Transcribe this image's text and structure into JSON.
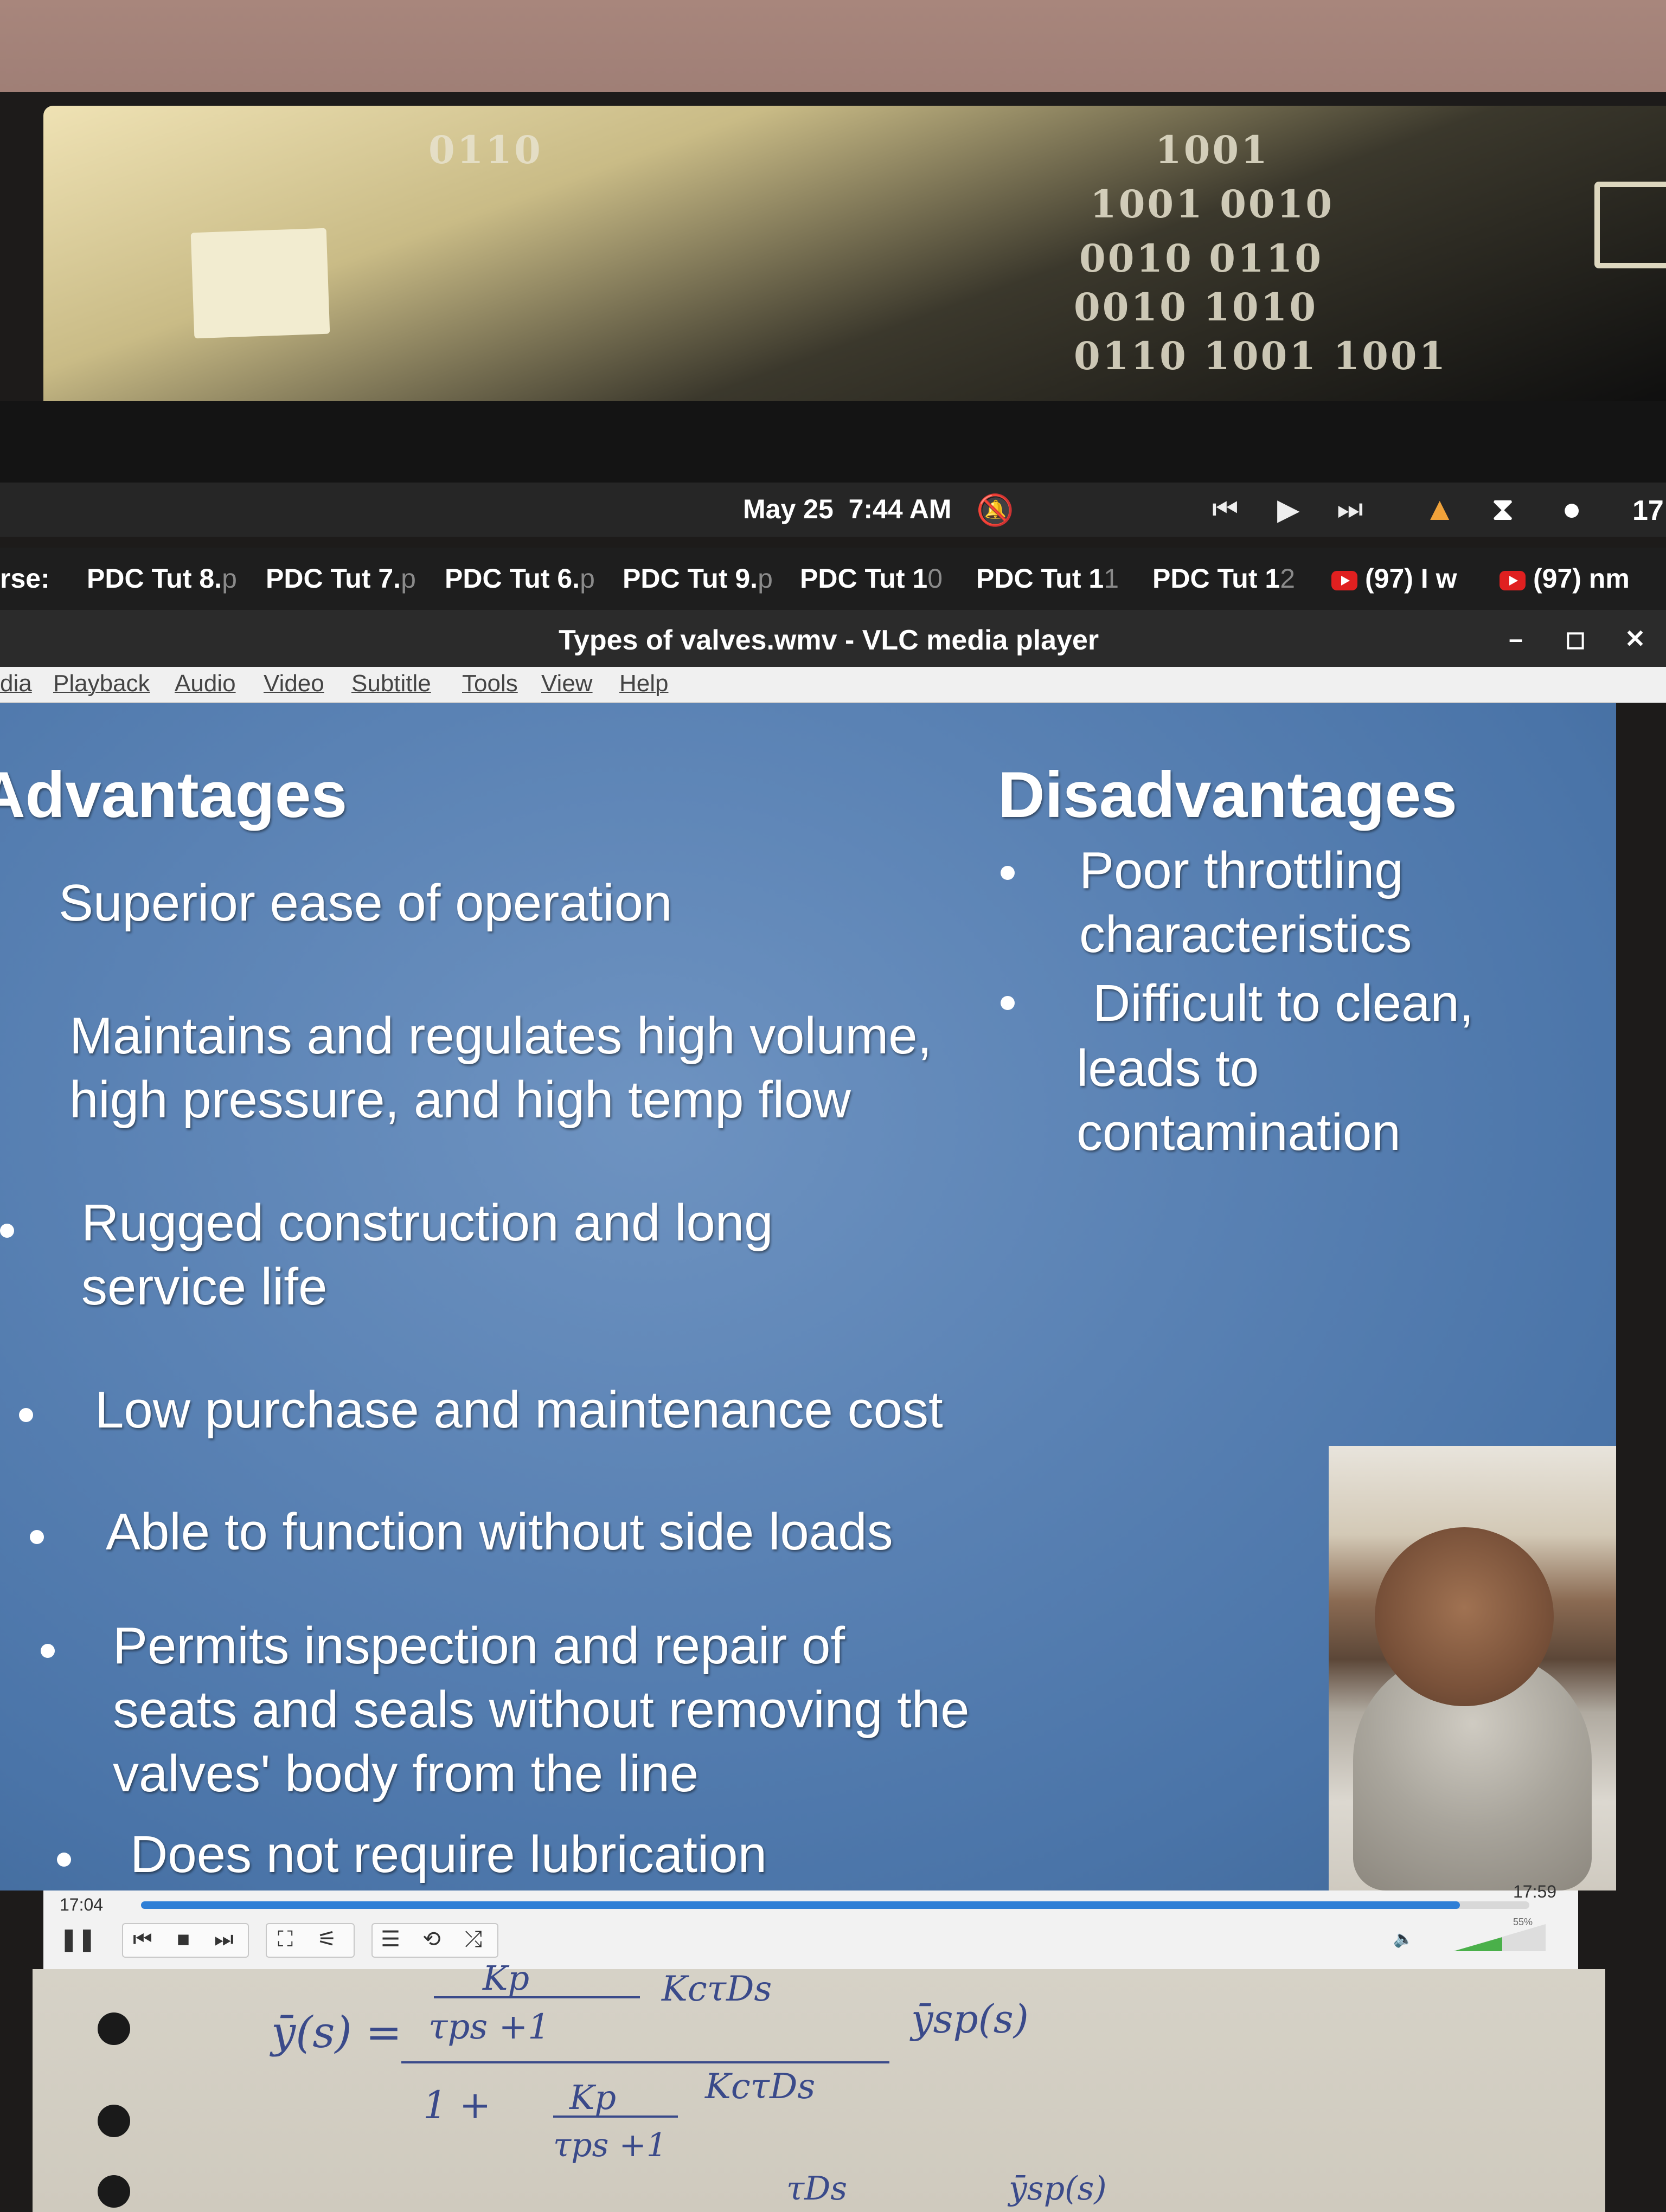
{
  "panel": {
    "date": "May 25",
    "time": "7:44 AM",
    "tray_number": "17"
  },
  "taskbar": {
    "items": [
      {
        "label": "rse:",
        "dim": ""
      },
      {
        "label": "PDC Tut 8.",
        "dim": "p"
      },
      {
        "label": "PDC Tut 7.",
        "dim": "p"
      },
      {
        "label": "PDC Tut 6.",
        "dim": "p"
      },
      {
        "label": "PDC Tut 9.",
        "dim": "p"
      },
      {
        "label": "PDC Tut 1",
        "dim": "0"
      },
      {
        "label": "PDC Tut 1",
        "dim": "1"
      },
      {
        "label": "PDC Tut 1",
        "dim": "2"
      },
      {
        "label": "(97) I w",
        "dim": ""
      },
      {
        "label": "(97) nm",
        "dim": ""
      }
    ]
  },
  "window": {
    "title": "Types of valves.wmv - VLC media player",
    "minimize": "–",
    "maximize": "◻",
    "close": "✕"
  },
  "menu": [
    "dia",
    "Playback",
    "Audio",
    "Video",
    "Subtitle",
    "Tools",
    "View",
    "Help"
  ],
  "slide": {
    "advantages_heading": "Advantages",
    "disadvantages_heading": "Disadvantages",
    "advantages": [
      {
        "lines": [
          "Superior ease of operation"
        ]
      },
      {
        "lines": [
          "Maintains and regulates high volume,",
          "high pressure, and high temp flow"
        ]
      },
      {
        "lines": [
          "Rugged construction and long",
          "service life"
        ]
      },
      {
        "lines": [
          "Low purchase and maintenance cost"
        ]
      },
      {
        "lines": [
          "Able to function without side loads"
        ]
      },
      {
        "lines": [
          "Permits inspection and repair of",
          "seats and seals without removing the",
          "valves' body from the line"
        ]
      },
      {
        "lines": [
          "Does not require lubrication"
        ]
      }
    ],
    "disadvantages": [
      {
        "lines": [
          "Poor throttling",
          "characteristics"
        ]
      },
      {
        "lines": [
          "Difficult to clean,",
          "leads to",
          "contamination"
        ]
      }
    ]
  },
  "player": {
    "elapsed": "17:04",
    "total": "17:59",
    "progress_fraction": 0.95,
    "volume_label": "55%",
    "volume_fraction": 0.55
  },
  "notes": {
    "lhs": "ȳ(s) =",
    "num_top": "Kp",
    "num_mid": "KcτDs",
    "num_den": "τps +1",
    "rhs": "ȳsp(s)",
    "den_one": "1 +",
    "den_top": "Kp",
    "den_mid": "KcτDs",
    "den_bottom": "τps +1",
    "bottom_a": "τDs",
    "bottom_b": "ȳsp(s)"
  },
  "wallpaper": {
    "binary": [
      "0110",
      "1001",
      "1001 0010",
      "0010 0110",
      "0010 1010",
      "0110 1001 1001"
    ]
  },
  "colors": {
    "slide_bg": "#5a82b4",
    "seek_fill": "#2f7fd6",
    "youtube_red": "#e02020"
  }
}
